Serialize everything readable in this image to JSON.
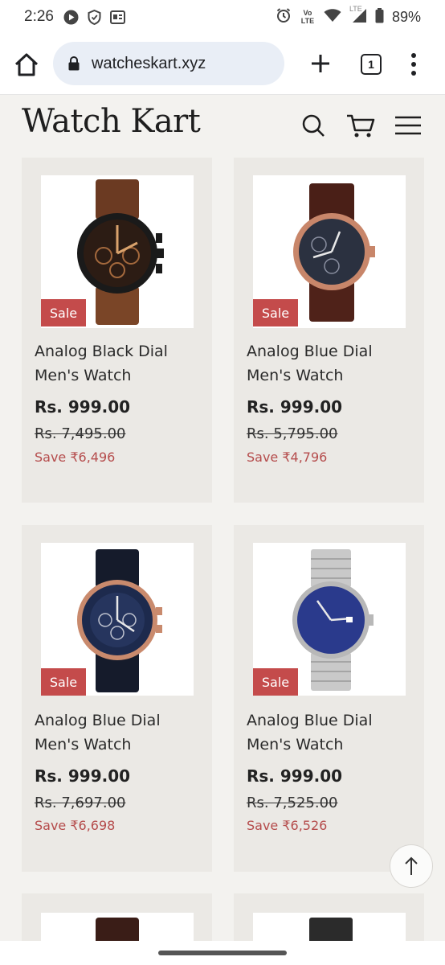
{
  "status_bar": {
    "time": "2:26",
    "battery": "89%",
    "network": "LTE",
    "volte": "Vo LTE"
  },
  "browser": {
    "url": "watcheskart.xyz",
    "tab_count": "1"
  },
  "site": {
    "logo": "Watch Kart"
  },
  "products": [
    {
      "title_line1": "Analog Black Dial",
      "title_line2": "Men's Watch",
      "price": "Rs. 999.00",
      "original_price": "Rs. 7,495.00",
      "save": "Save ₹6,496",
      "badge": "Sale",
      "image": "fossil-black-dial-brown-strap"
    },
    {
      "title_line1": "Analog Blue Dial",
      "title_line2": "Men's Watch",
      "price": "Rs. 999.00",
      "original_price": "Rs. 5,795.00",
      "save": "Save ₹4,796",
      "badge": "Sale",
      "image": "titan-blue-dial-brown-strap"
    },
    {
      "title_line1": "Analog Blue Dial",
      "title_line2": "Men's Watch",
      "price": "Rs. 999.00",
      "original_price": "Rs. 7,697.00",
      "save": "Save ₹6,698",
      "badge": "Sale",
      "image": "fossil-blue-dial-navy-strap"
    },
    {
      "title_line1": "Analog Blue Dial",
      "title_line2": "Men's Watch",
      "price": "Rs. 999.00",
      "original_price": "Rs. 7,525.00",
      "save": "Save ₹6,526",
      "badge": "Sale",
      "image": "timex-blue-dial-steel-bracelet"
    }
  ],
  "colors": {
    "page_bg": "#f3f2ef",
    "card_bg": "#ebe9e5",
    "sale_badge": "#c44b4b",
    "save_text": "#b54c4c"
  }
}
